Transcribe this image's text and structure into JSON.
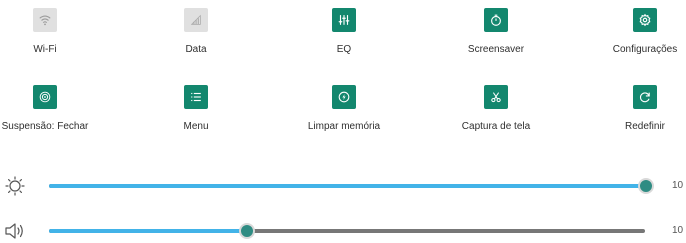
{
  "quick_settings": {
    "row1": [
      {
        "label": "Wi-Fi",
        "icon": "wifi-icon",
        "state": "off"
      },
      {
        "label": "Data",
        "icon": "mobile-data-icon",
        "state": "off"
      },
      {
        "label": "EQ",
        "icon": "equalizer-icon",
        "state": "on"
      },
      {
        "label": "Screensaver",
        "icon": "timer-icon",
        "state": "on"
      },
      {
        "label": "Configurações",
        "icon": "gear-icon",
        "state": "on"
      }
    ],
    "row2": [
      {
        "label": "Suspensão: Fechar",
        "icon": "sleep-icon",
        "state": "on"
      },
      {
        "label": "Menu",
        "icon": "menu-icon",
        "state": "on"
      },
      {
        "label": "Limpar memória",
        "icon": "clear-memory-icon",
        "state": "on"
      },
      {
        "label": "Captura de tela",
        "icon": "scissors-icon",
        "state": "on"
      },
      {
        "label": "Redefinir",
        "icon": "reset-icon",
        "state": "on"
      }
    ]
  },
  "sliders": {
    "brightness": {
      "icon": "brightness-icon",
      "value": "10",
      "level": 1.0
    },
    "volume": {
      "icon": "volume-icon",
      "value": "10",
      "level": 0.33
    }
  },
  "colors": {
    "accent": "#13876e",
    "inactive": "#e0e0e0",
    "slider_fill": "#42b3e8",
    "slider_track": "#777777"
  }
}
